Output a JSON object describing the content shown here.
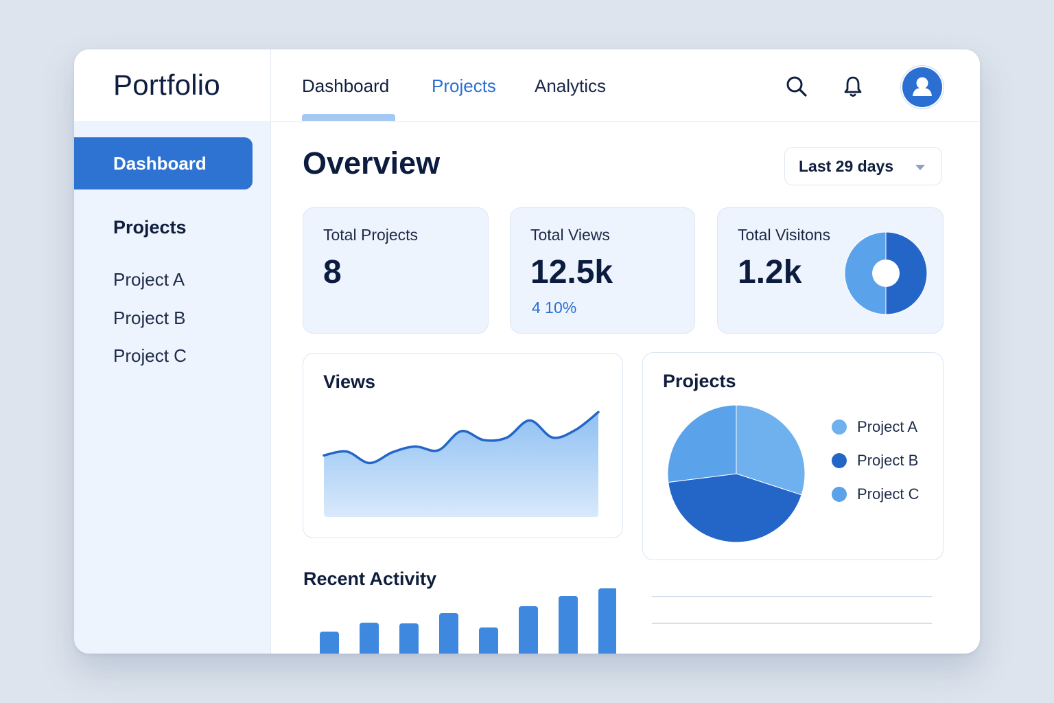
{
  "app": {
    "brand": "Portfolio"
  },
  "topnav": {
    "tabs": [
      {
        "label": "Dashboard",
        "state": "active"
      },
      {
        "label": "Projects",
        "state": "highlight"
      },
      {
        "label": "Analytics",
        "state": "normal"
      }
    ],
    "icons": [
      "search-icon",
      "bell-icon",
      "user-avatar-icon"
    ]
  },
  "sidebar": {
    "active_item": "Dashboard",
    "section_heading": "Projects",
    "items": [
      "Project A",
      "Project B",
      "Project C"
    ]
  },
  "main": {
    "title": "Overview",
    "date_range": "Last 29 days"
  },
  "stats": {
    "projects": {
      "label": "Total Projects",
      "value": "8"
    },
    "views": {
      "label": "Total Views",
      "value": "12.5k",
      "delta": "4 10%"
    },
    "visitors": {
      "label": "Total Visitons",
      "value": "1.2k"
    }
  },
  "panels": {
    "views_title": "Views",
    "projects_title": "Projects",
    "activity_title": "Recent Activity"
  },
  "colors": {
    "accent": "#2e73d2",
    "accent_light": "#6eb1ee",
    "sidebar_bg": "#eef4fd",
    "card_bg": "#eef4fd",
    "text_dark": "#0f1e3d"
  },
  "chart_data": [
    {
      "type": "pie",
      "name": "visitors-donut",
      "labels": [
        "",
        ""
      ],
      "values": [
        50,
        50
      ],
      "colors": [
        "#2466c8",
        "#5aa2ea"
      ]
    },
    {
      "type": "area",
      "name": "views-area",
      "x": [
        1,
        2,
        3,
        4,
        5,
        6,
        7,
        8,
        9,
        10,
        11,
        12,
        13
      ],
      "values": [
        32,
        38,
        20,
        37,
        46,
        40,
        70,
        56,
        60,
        87,
        60,
        72,
        100
      ],
      "ylim": [
        0,
        110
      ]
    },
    {
      "type": "pie",
      "name": "projects-pie",
      "labels": [
        "Project A",
        "Project B",
        "Project C"
      ],
      "values": [
        30,
        43,
        27
      ],
      "colors": [
        "#6eb1ee",
        "#2466c8",
        "#5aa2ea"
      ]
    },
    {
      "type": "bar",
      "name": "recent-activity",
      "categories": [
        "1",
        "2",
        "3",
        "4",
        "5",
        "6",
        "7",
        "8"
      ],
      "values": [
        32,
        45,
        44,
        59,
        38,
        69,
        84,
        95
      ],
      "ylim": [
        0,
        100
      ]
    }
  ]
}
